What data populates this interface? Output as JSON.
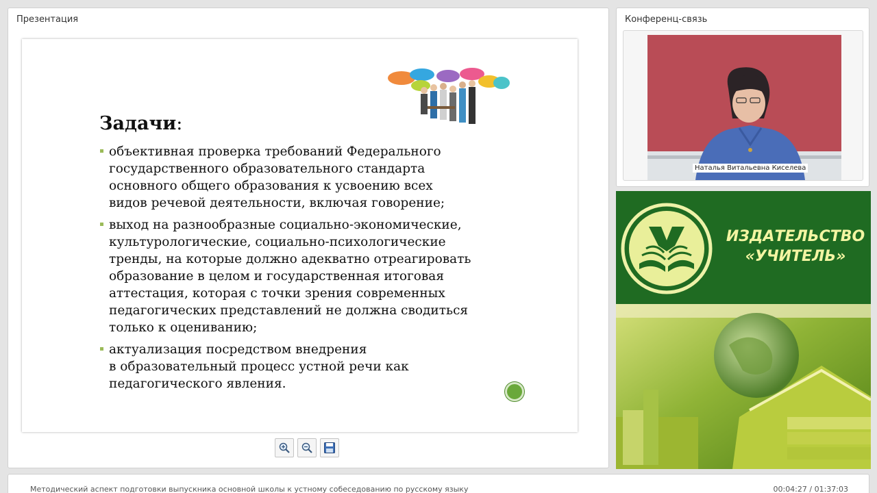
{
  "presentation": {
    "title": "Презентация",
    "slide": {
      "heading": "Задачи",
      "heading_colon": ":",
      "bullets": [
        "объективная проверка требований Федерального\nгосударственного образовательного стандарта\nосновного общего образования к усвоению всех\nвидов речевой деятельности, включая говорение;",
        "выход на разнообразные социально-экономические,\nкультурологические, социально-психологические\nтренды, на которые должно адекватно отреагировать\nобразование в целом и государственная итоговая\nаттестация, которая с точки зрения  современных\nпедагогических представлений не должна сводиться\nтолько к оцениванию;",
        "актуализация посредством внедрения\nв образовательный процесс устной речи как\nпедагогического явления."
      ]
    },
    "toolbar": {
      "zoom_in_icon": "zoom-in-icon",
      "zoom_out_icon": "zoom-out-icon",
      "save_icon": "save-icon"
    }
  },
  "conference": {
    "title": "Конференц-связь",
    "speaker_name": "Наталья Витальевна Киселева"
  },
  "banner": {
    "title": "ИЗДАТЕЛЬСТВО\n«УЧИТЕЛЬ»"
  },
  "footer": {
    "webinar_title": "Методический аспект подготовки выпускника основной школы к устному собеседованию по русскому языку",
    "elapsed": "00:04:27",
    "separator": " / ",
    "total": "01:37:03"
  },
  "colors": {
    "bullet": "#9bbb59",
    "banner_green": "#1f6b22",
    "banner_text": "#f3f5a2",
    "video_bg": "#b94c56"
  }
}
